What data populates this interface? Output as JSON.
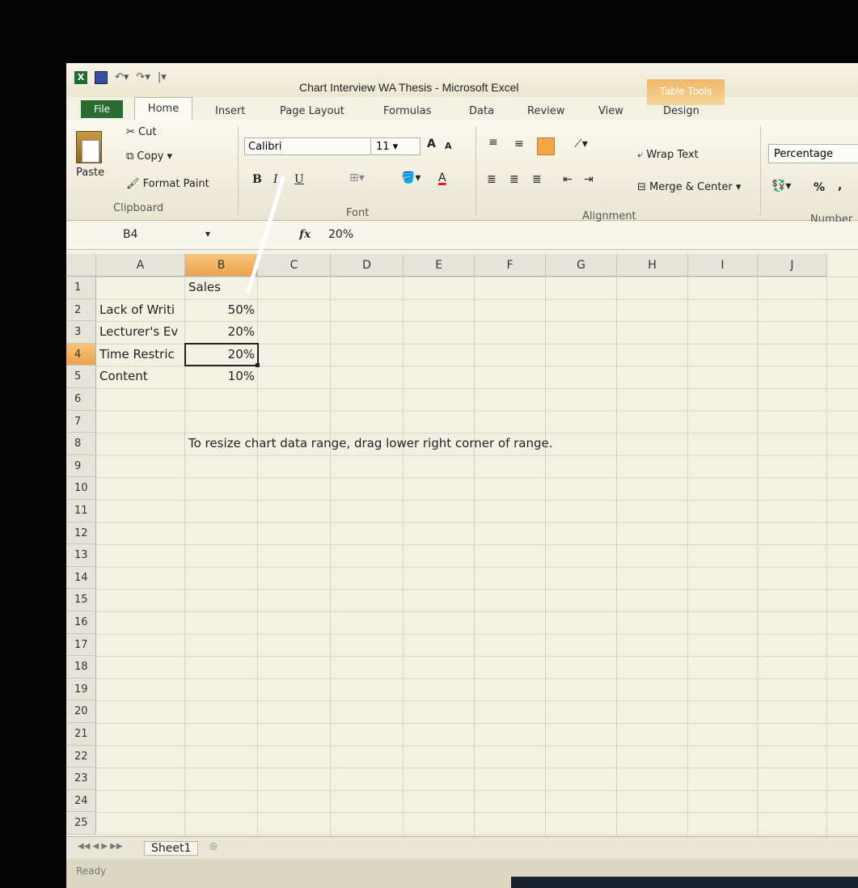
{
  "window": {
    "title": "Chart Interview WA Thesis  -  Microsoft Excel",
    "table_tools_label": "Table Tools",
    "qat_icons": [
      "excel-logo-icon",
      "save-icon",
      "undo-icon",
      "redo-icon",
      "customize-qat-icon"
    ]
  },
  "ribbon": {
    "tabs": [
      "File",
      "Home",
      "Insert",
      "Page Layout",
      "Formulas",
      "Data",
      "Review",
      "View",
      "Design"
    ],
    "active_tab": "Home",
    "clipboard": {
      "paste": "Paste",
      "cut": "Cut",
      "copy": "Copy",
      "format_painter": "Format Paint",
      "group": "Clipboard"
    },
    "font": {
      "name": "Calibri",
      "size": "11",
      "bold": "B",
      "italic": "I",
      "underline": "U",
      "grow": "A",
      "shrink": "A",
      "font_color": "A",
      "group": "Font"
    },
    "alignment": {
      "wrap_text": "Wrap Text",
      "merge_center": "Merge & Center",
      "group": "Alignment"
    },
    "number": {
      "format": "Percentage",
      "percent": "%",
      "comma": ",",
      "group": "Number"
    }
  },
  "formula_bar": {
    "name_box": "B4",
    "fx": "fx",
    "value": "20%"
  },
  "columns": [
    "A",
    "B",
    "C",
    "D",
    "E",
    "F",
    "G",
    "H",
    "I",
    "J"
  ],
  "selected_column": "B",
  "rows": [
    "1",
    "2",
    "3",
    "4",
    "5",
    "6",
    "7",
    "8",
    "9",
    "10",
    "11",
    "12",
    "13",
    "14",
    "15",
    "16",
    "17",
    "18",
    "19",
    "20",
    "21",
    "22",
    "23",
    "24",
    "25"
  ],
  "selected_row": "4",
  "cells": {
    "B1": "Sales",
    "A2": "Lack of Writi",
    "B2": "50%",
    "A3": "Lecturer's Ev",
    "B3": "20%",
    "A4": "Time Restric",
    "B4": "20%",
    "A5": "Content",
    "B5": "10%",
    "B8": "To resize chart data range, drag lower right corner of range."
  },
  "sheet_tabs": [
    "Sheet1"
  ],
  "status": "Ready",
  "colors": {
    "file_tab": "#2a6b31",
    "selection_header": "#eda24d",
    "table_tools": "#f0b867"
  }
}
